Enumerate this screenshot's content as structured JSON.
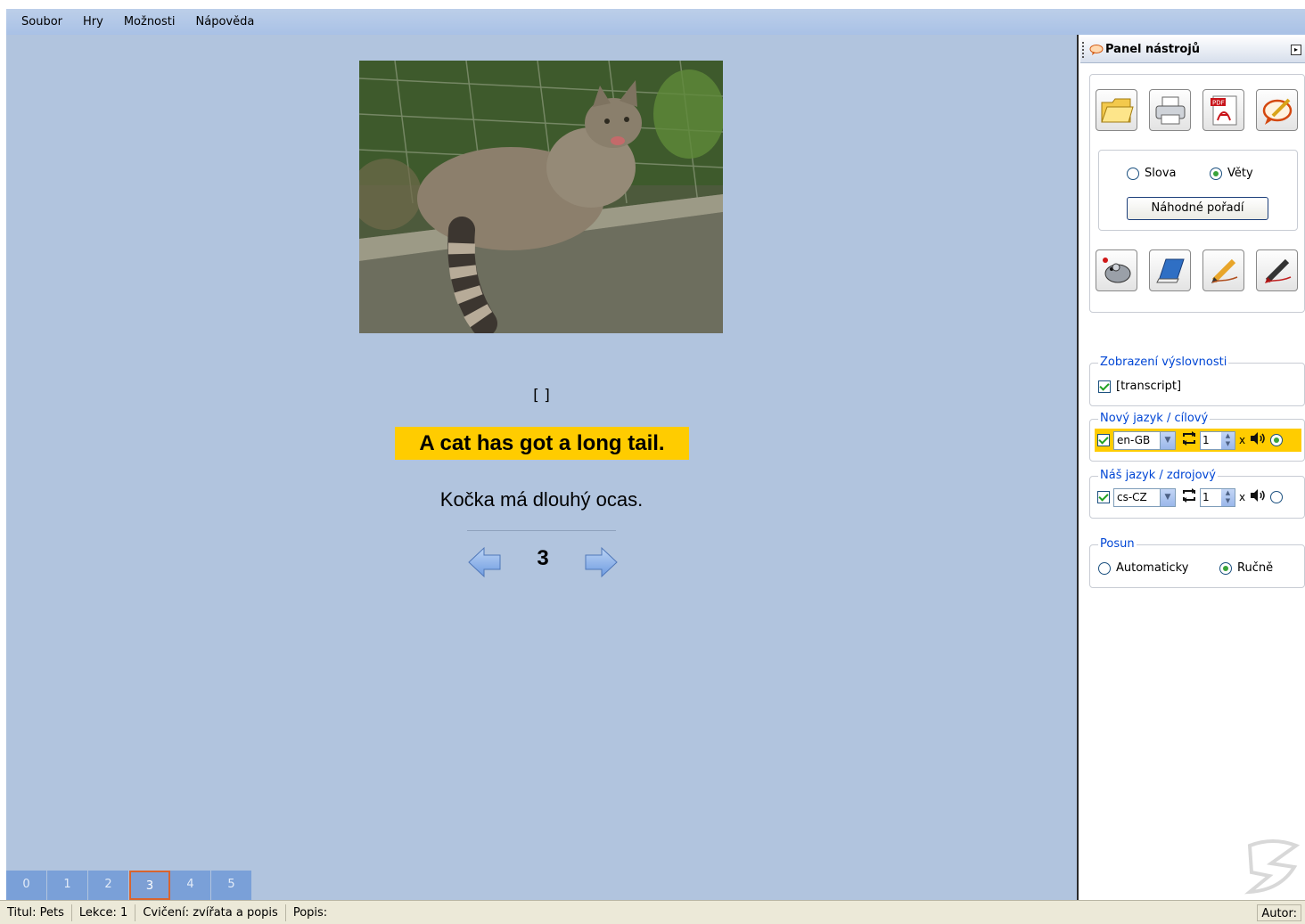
{
  "menubar": {
    "items": [
      "Soubor",
      "Hry",
      "Možnosti",
      "Nápověda"
    ]
  },
  "card": {
    "transcript": "[ ]",
    "target_sentence": "A cat has got a long tail.",
    "source_sentence": "Kočka má dlouhý ocas.",
    "page_number": "3"
  },
  "lesson_tabs": {
    "items": [
      "0",
      "1",
      "2",
      "3",
      "4",
      "5"
    ],
    "active_index": 3
  },
  "toolpanel": {
    "title": "Panel nástrojů",
    "mode": {
      "words_label": "Slova",
      "sentences_label": "Věty",
      "selected": "Věty",
      "random_label": "Náhodné pořadí"
    },
    "pronunciation": {
      "legend": "Zobrazení výslovnosti",
      "checkbox_label": "[transcript]",
      "checked": true
    },
    "target_language": {
      "legend": "Nový jazyk / cílový",
      "code": "en-GB",
      "repeat": "1",
      "times": "x",
      "checked": true,
      "active": true
    },
    "source_language": {
      "legend": "Náš jazyk / zdrojový",
      "code": "cs-CZ",
      "repeat": "1",
      "times": "x",
      "checked": true,
      "active": false
    },
    "advance": {
      "legend": "Posun",
      "auto_label": "Automaticky",
      "manual_label": "Ručně",
      "selected": "Ručně"
    }
  },
  "statusbar": {
    "title": "Titul: Pets",
    "lesson": "Lekce: 1",
    "exercise": "Cvičení: zvířata a popis",
    "description": "Popis:",
    "author": "Autor:"
  },
  "colors": {
    "highlight": "#ffcc00",
    "background": "#b1c4de",
    "tab": "#7aa0d8",
    "active_tab_border": "#d8642f"
  }
}
